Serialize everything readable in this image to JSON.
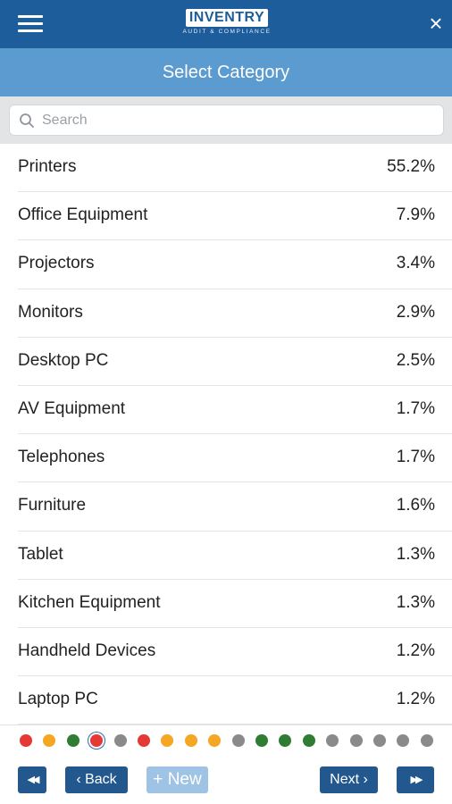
{
  "header": {
    "logo_main": "INVENTRY",
    "logo_sub": "AUDIT & COMPLIANCE",
    "close_glyph": "×"
  },
  "title": "Select Category",
  "search": {
    "placeholder": "Search",
    "value": ""
  },
  "categories": [
    {
      "name": "Printers",
      "percent": "55.2%"
    },
    {
      "name": "Office Equipment",
      "percent": "7.9%"
    },
    {
      "name": "Projectors",
      "percent": "3.4%"
    },
    {
      "name": "Monitors",
      "percent": "2.9%"
    },
    {
      "name": "Desktop PC",
      "percent": "2.5%"
    },
    {
      "name": "AV Equipment",
      "percent": "1.7%"
    },
    {
      "name": "Telephones",
      "percent": "1.7%"
    },
    {
      "name": "Furniture",
      "percent": "1.6%"
    },
    {
      "name": "Tablet",
      "percent": "1.3%"
    },
    {
      "name": "Kitchen Equipment",
      "percent": "1.3%"
    },
    {
      "name": "Handheld Devices",
      "percent": "1.2%"
    },
    {
      "name": "Laptop PC",
      "percent": "1.2%"
    }
  ],
  "status_dots": [
    {
      "color": "#e53935",
      "selected": false
    },
    {
      "color": "#f5a623",
      "selected": false
    },
    {
      "color": "#2e7d32",
      "selected": false
    },
    {
      "color": "#e53935",
      "selected": true
    },
    {
      "color": "#8a8a8a",
      "selected": false
    },
    {
      "color": "#e53935",
      "selected": false
    },
    {
      "color": "#f5a623",
      "selected": false
    },
    {
      "color": "#f5a623",
      "selected": false
    },
    {
      "color": "#f5a623",
      "selected": false
    },
    {
      "color": "#8a8a8a",
      "selected": false
    },
    {
      "color": "#2e7d32",
      "selected": false
    },
    {
      "color": "#2e7d32",
      "selected": false
    },
    {
      "color": "#2e7d32",
      "selected": false
    },
    {
      "color": "#8a8a8a",
      "selected": false
    },
    {
      "color": "#8a8a8a",
      "selected": false
    },
    {
      "color": "#8a8a8a",
      "selected": false
    },
    {
      "color": "#8a8a8a",
      "selected": false
    },
    {
      "color": "#8a8a8a",
      "selected": false
    }
  ],
  "footer": {
    "first_glyph": "◀◀",
    "back_glyph": "‹",
    "back_label": "Back",
    "new_glyph": "+",
    "new_label": "New",
    "next_label": "Next",
    "next_glyph": "›",
    "last_glyph": "▶▶"
  },
  "colors": {
    "primary": "#1d5d9b",
    "title_bar": "#5b9bd0",
    "button": "#23588f",
    "button_light": "#9fc3e5"
  }
}
